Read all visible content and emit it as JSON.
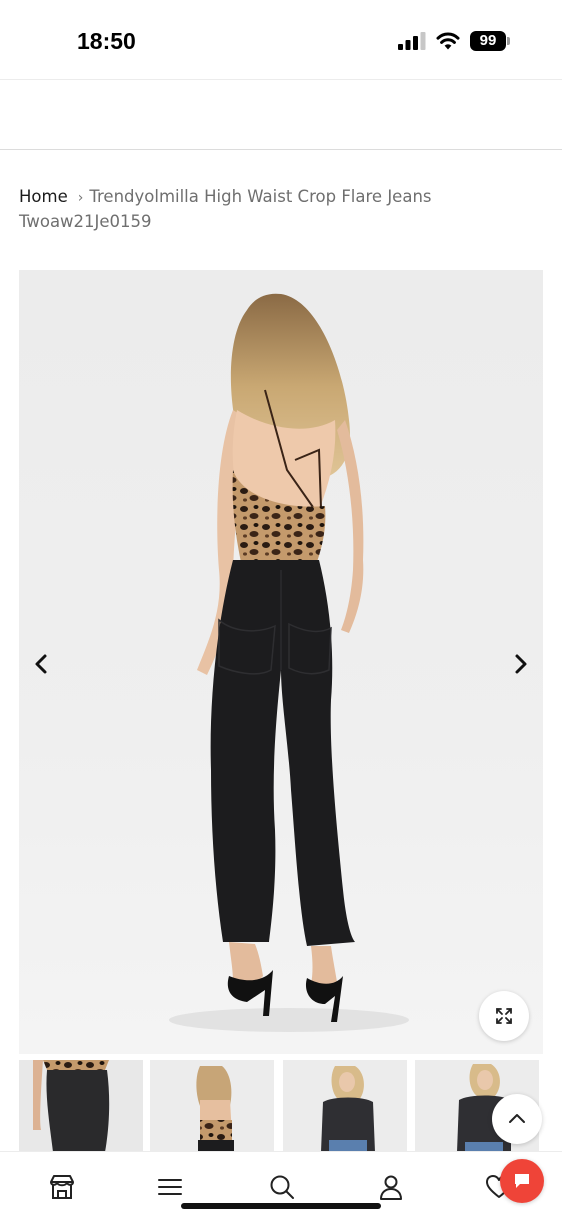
{
  "status_bar": {
    "time": "18:50",
    "battery": "99",
    "icons": [
      "signal-icon",
      "wifi-icon",
      "battery-icon"
    ]
  },
  "breadcrumb": {
    "home": "Home",
    "separator": "›",
    "current": "Trendyolmilla High Waist Crop Flare Jeans Twoaw21Je0159"
  },
  "gallery": {
    "prev_icon": "chevron-left-icon",
    "next_icon": "chevron-right-icon",
    "zoom_icon": "expand-icon",
    "thumbnail_count": 4
  },
  "scroll_top_icon": "chevron-up-icon",
  "bottom_nav": {
    "items": [
      {
        "icon": "store-icon"
      },
      {
        "icon": "menu-icon"
      },
      {
        "icon": "search-icon"
      },
      {
        "icon": "account-icon"
      },
      {
        "icon": "heart-icon"
      }
    ]
  },
  "chat_icon": "chat-bubble-icon",
  "colors": {
    "accent_chat": "#ef4438",
    "breadcrumb_text": "#6f6f6f",
    "jeans": "#1c1c1e"
  }
}
